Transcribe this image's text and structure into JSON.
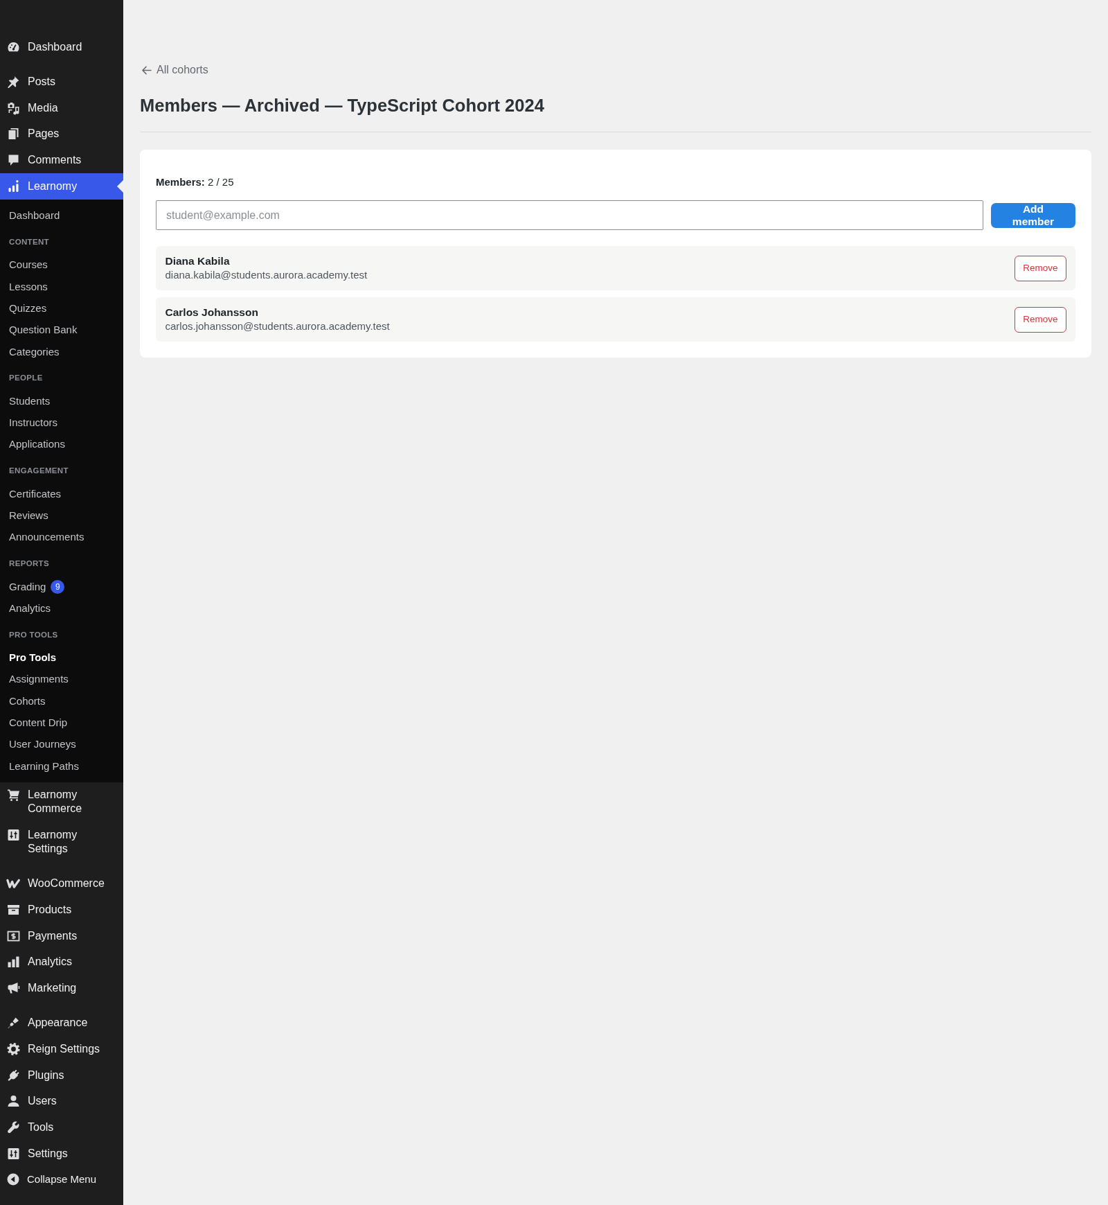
{
  "sidebar": {
    "menu_groups": [
      [
        {
          "label": "Dashboard",
          "selected": false
        }
      ],
      [
        {
          "label": "Posts",
          "selected": false
        },
        {
          "label": "Media",
          "selected": false
        },
        {
          "label": "Pages",
          "selected": false
        },
        {
          "label": "Comments",
          "selected": false
        },
        {
          "label": "Learnomy",
          "selected": true,
          "submenu": [
            {
              "kind": "link",
              "label": "Dashboard",
              "selected": false
            },
            {
              "kind": "heading",
              "label": "CONTENT"
            },
            {
              "kind": "link",
              "label": "Courses",
              "selected": false
            },
            {
              "kind": "link",
              "label": "Lessons",
              "selected": false
            },
            {
              "kind": "link",
              "label": "Quizzes",
              "selected": false
            },
            {
              "kind": "link",
              "label": "Question Bank",
              "selected": false
            },
            {
              "kind": "link",
              "label": "Categories",
              "selected": false
            },
            {
              "kind": "heading",
              "label": "PEOPLE"
            },
            {
              "kind": "link",
              "label": "Students",
              "selected": false
            },
            {
              "kind": "link",
              "label": "Instructors",
              "selected": false
            },
            {
              "kind": "link",
              "label": "Applications",
              "selected": false
            },
            {
              "kind": "heading",
              "label": "ENGAGEMENT"
            },
            {
              "kind": "link",
              "label": "Certificates",
              "selected": false
            },
            {
              "kind": "link",
              "label": "Reviews",
              "selected": false
            },
            {
              "kind": "link",
              "label": "Announcements",
              "selected": false
            },
            {
              "kind": "heading",
              "label": "REPORTS"
            },
            {
              "kind": "link",
              "label": "Grading",
              "selected": false,
              "badge": "9"
            },
            {
              "kind": "link",
              "label": "Analytics",
              "selected": false
            },
            {
              "kind": "heading",
              "label": "PRO TOOLS"
            },
            {
              "kind": "link",
              "label": "Pro Tools",
              "selected": true
            },
            {
              "kind": "link",
              "label": "Assignments",
              "selected": false
            },
            {
              "kind": "link",
              "label": "Cohorts",
              "selected": false
            },
            {
              "kind": "link",
              "label": "Content Drip",
              "selected": false
            },
            {
              "kind": "link",
              "label": "User Journeys",
              "selected": false
            },
            {
              "kind": "link",
              "label": "Learning Paths",
              "selected": false
            }
          ]
        },
        {
          "label": "Learnomy Commerce",
          "selected": false
        },
        {
          "label": "Learnomy Settings",
          "selected": false
        }
      ],
      [
        {
          "label": "WooCommerce",
          "selected": false
        },
        {
          "label": "Products",
          "selected": false
        },
        {
          "label": "Payments",
          "selected": false
        },
        {
          "label": "Analytics",
          "selected": false
        },
        {
          "label": "Marketing",
          "selected": false
        }
      ],
      [
        {
          "label": "Appearance",
          "selected": false
        },
        {
          "label": "Reign Settings",
          "selected": false
        },
        {
          "label": "Plugins",
          "selected": false
        },
        {
          "label": "Users",
          "selected": false
        },
        {
          "label": "Tools",
          "selected": false
        },
        {
          "label": "Settings",
          "selected": false
        }
      ]
    ],
    "collapse_button": {
      "label": "Collapse Menu"
    }
  },
  "page": {
    "back_link": "All cohorts",
    "title": "Members — Archived — TypeScript Cohort 2024"
  },
  "members_card": {
    "count": "**Members:** 2 / 25",
    "email_field": {
      "placeholder": "student@example.com"
    },
    "add_button": "Add member",
    "members": [
      {
        "name": "Diana Kabila",
        "email": "diana.kabila@students.aurora.academy.test",
        "remove_button": "Remove"
      },
      {
        "name": "Carlos Johansson",
        "email": "carlos.johansson@students.aurora.academy.test",
        "remove_button": "Remove"
      }
    ]
  }
}
